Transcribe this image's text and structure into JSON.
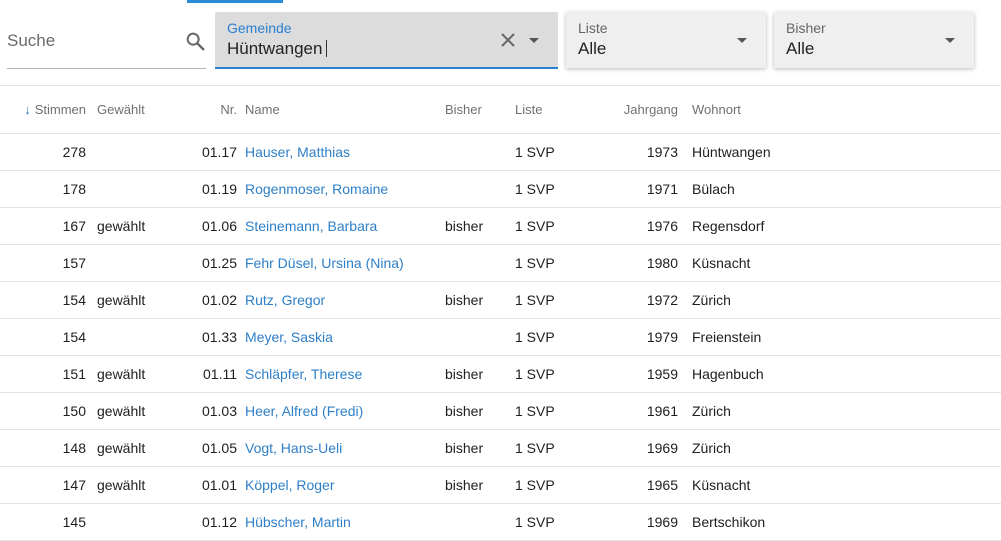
{
  "search": {
    "placeholder": "Suche",
    "icon": "search-icon"
  },
  "filters": {
    "gemeinde": {
      "label": "Gemeinde",
      "value": "Hüntwangen"
    },
    "liste": {
      "label": "Liste",
      "value": "Alle"
    },
    "bisher": {
      "label": "Bisher",
      "value": "Alle"
    }
  },
  "table": {
    "headers": {
      "stimmen": "Stimmen",
      "gewaehlt": "Gewählt",
      "nr": "Nr.",
      "name": "Name",
      "bisher": "Bisher",
      "liste": "Liste",
      "jahrgang": "Jahrgang",
      "wohnort": "Wohnort"
    },
    "sort_direction": "descending",
    "rows": [
      {
        "stimmen": "278",
        "gewaehlt": "",
        "nr": "01.17",
        "name": "Hauser, Matthias",
        "bisher": "",
        "liste": "1 SVP",
        "jahrgang": "1973",
        "wohnort": "Hüntwangen"
      },
      {
        "stimmen": "178",
        "gewaehlt": "",
        "nr": "01.19",
        "name": "Rogenmoser, Romaine",
        "bisher": "",
        "liste": "1 SVP",
        "jahrgang": "1971",
        "wohnort": "Bülach"
      },
      {
        "stimmen": "167",
        "gewaehlt": "gewählt",
        "nr": "01.06",
        "name": "Steinemann, Barbara",
        "bisher": "bisher",
        "liste": "1 SVP",
        "jahrgang": "1976",
        "wohnort": "Regensdorf"
      },
      {
        "stimmen": "157",
        "gewaehlt": "",
        "nr": "01.25",
        "name": "Fehr Düsel, Ursina (Nina)",
        "bisher": "",
        "liste": "1 SVP",
        "jahrgang": "1980",
        "wohnort": "Küsnacht"
      },
      {
        "stimmen": "154",
        "gewaehlt": "gewählt",
        "nr": "01.02",
        "name": "Rutz, Gregor",
        "bisher": "bisher",
        "liste": "1 SVP",
        "jahrgang": "1972",
        "wohnort": "Zürich"
      },
      {
        "stimmen": "154",
        "gewaehlt": "",
        "nr": "01.33",
        "name": "Meyer, Saskia",
        "bisher": "",
        "liste": "1 SVP",
        "jahrgang": "1979",
        "wohnort": "Freienstein"
      },
      {
        "stimmen": "151",
        "gewaehlt": "gewählt",
        "nr": "01.11",
        "name": "Schläpfer, Therese",
        "bisher": "bisher",
        "liste": "1 SVP",
        "jahrgang": "1959",
        "wohnort": "Hagenbuch"
      },
      {
        "stimmen": "150",
        "gewaehlt": "gewählt",
        "nr": "01.03",
        "name": "Heer, Alfred (Fredi)",
        "bisher": "bisher",
        "liste": "1 SVP",
        "jahrgang": "1961",
        "wohnort": "Zürich"
      },
      {
        "stimmen": "148",
        "gewaehlt": "gewählt",
        "nr": "01.05",
        "name": "Vogt, Hans-Ueli",
        "bisher": "bisher",
        "liste": "1 SVP",
        "jahrgang": "1969",
        "wohnort": "Zürich"
      },
      {
        "stimmen": "147",
        "gewaehlt": "gewählt",
        "nr": "01.01",
        "name": "Köppel, Roger",
        "bisher": "bisher",
        "liste": "1 SVP",
        "jahrgang": "1965",
        "wohnort": "Küsnacht"
      },
      {
        "stimmen": "145",
        "gewaehlt": "",
        "nr": "01.12",
        "name": "Hübscher, Martin",
        "bisher": "",
        "liste": "1 SVP",
        "jahrgang": "1969",
        "wohnort": "Bertschikon"
      }
    ]
  },
  "colors": {
    "accent": "#2a7fd0",
    "link": "#2e7fc8"
  }
}
